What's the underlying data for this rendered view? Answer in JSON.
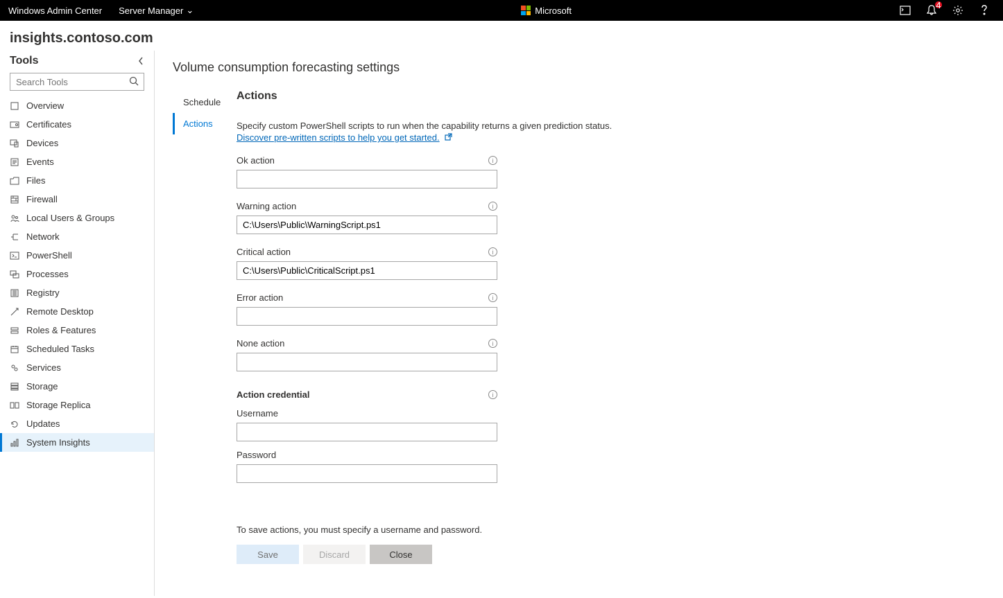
{
  "topbar": {
    "product": "Windows Admin Center",
    "dropdown": "Server Manager",
    "brand": "Microsoft",
    "notif_count": "4"
  },
  "server": "insights.contoso.com",
  "sidebar": {
    "title": "Tools",
    "search_placeholder": "Search Tools",
    "items": [
      {
        "label": "Overview"
      },
      {
        "label": "Certificates"
      },
      {
        "label": "Devices"
      },
      {
        "label": "Events"
      },
      {
        "label": "Files"
      },
      {
        "label": "Firewall"
      },
      {
        "label": "Local Users & Groups"
      },
      {
        "label": "Network"
      },
      {
        "label": "PowerShell"
      },
      {
        "label": "Processes"
      },
      {
        "label": "Registry"
      },
      {
        "label": "Remote Desktop"
      },
      {
        "label": "Roles & Features"
      },
      {
        "label": "Scheduled Tasks"
      },
      {
        "label": "Services"
      },
      {
        "label": "Storage"
      },
      {
        "label": "Storage Replica"
      },
      {
        "label": "Updates"
      },
      {
        "label": "System Insights"
      }
    ]
  },
  "page": {
    "title": "Volume consumption forecasting settings",
    "tabs": {
      "schedule": "Schedule",
      "actions": "Actions"
    },
    "heading": "Actions",
    "description": "Specify custom PowerShell scripts to run when the capability returns a given prediction status.",
    "link_text": "Discover pre-written scripts to help you get started.",
    "fields": {
      "ok": {
        "label": "Ok action",
        "value": ""
      },
      "warning": {
        "label": "Warning action",
        "value": "C:\\Users\\Public\\WarningScript.ps1"
      },
      "critical": {
        "label": "Critical action",
        "value": "C:\\Users\\Public\\CriticalScript.ps1"
      },
      "error": {
        "label": "Error action",
        "value": ""
      },
      "none": {
        "label": "None action",
        "value": ""
      }
    },
    "cred": {
      "heading": "Action credential",
      "username_label": "Username",
      "username_value": "",
      "password_label": "Password",
      "password_value": ""
    },
    "hint": "To save actions, you must specify a username and password.",
    "buttons": {
      "save": "Save",
      "discard": "Discard",
      "close": "Close"
    }
  }
}
